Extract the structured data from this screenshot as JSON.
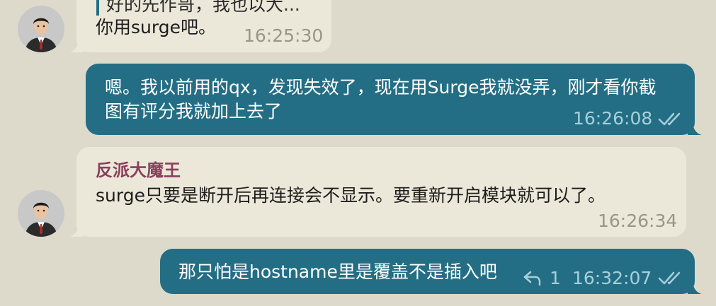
{
  "colors": {
    "background": "#ddd9cb",
    "incoming_bubble": "#ece8d9",
    "outgoing_bubble": "#236e84",
    "sender_name": "#8a3f5c"
  },
  "messages": [
    {
      "direction": "incoming",
      "quote_text": "好的先作哥，我也以大...",
      "text": "你用surge吧。",
      "time": "16:25:30"
    },
    {
      "direction": "outgoing",
      "text_line1": "嗯。我以前用的qx，发现失效了，现在用Surge我就没弄，刚才看你截",
      "text_line2": "图有评分我就加上去了",
      "time": "16:26:08",
      "status_icon": "double-check-icon"
    },
    {
      "direction": "incoming",
      "sender": "反派大魔王",
      "text": "surge只要是断开后再连接会不显示。要重新开启模块就可以了。",
      "time": "16:26:34"
    },
    {
      "direction": "outgoing",
      "text": "那只怕是hostname里是覆盖不是插入吧",
      "reply_icon": "reply-icon",
      "reply_count": "1",
      "time": "16:32:07",
      "status_icon": "double-check-icon"
    }
  ]
}
